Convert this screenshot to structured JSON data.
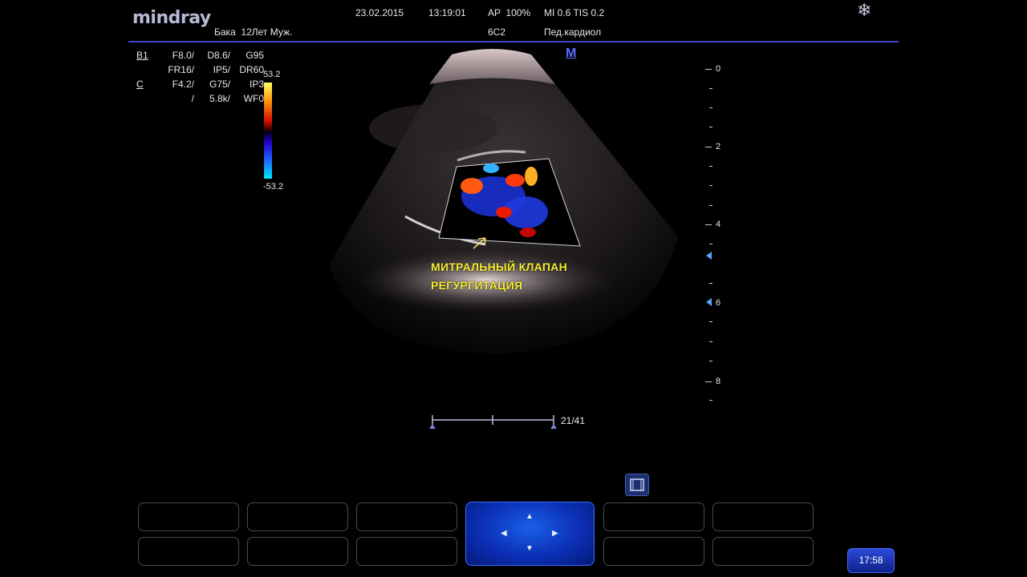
{
  "header": {
    "brand": "mindray",
    "date": "23.02.2015",
    "time": "13:19:01",
    "ap": "AP  100%",
    "mi_tis": "MI 0.6 TIS 0.2",
    "patient": "Бака  12Лет Муж.",
    "probe": "6C2",
    "preset": "Пед.кардиол",
    "freeze_icon": "snowflake-icon"
  },
  "params": {
    "rows": [
      {
        "k": "B1",
        "c1": "F8.0/",
        "c2": "D8.6/",
        "c3": "G95"
      },
      {
        "k": "",
        "c1": "FR16/",
        "c2": "IP5/",
        "c3": "DR60"
      },
      {
        "k": "C",
        "c1": "F4.2/",
        "c2": "G75/",
        "c3": "IP3"
      },
      {
        "k": "",
        "c1": "/",
        "c2": "5.8k/",
        "c3": "WF0"
      }
    ]
  },
  "colorbar": {
    "max": "53.2",
    "min": "-53.2"
  },
  "marker": "M",
  "depth_scale": {
    "labels": [
      "0",
      "2",
      "4",
      "6",
      "8"
    ]
  },
  "annotation": {
    "line1": "МИТРАЛЬНЫЙ КЛАПАН",
    "line2": "РЕГУРГИТАЦИЯ"
  },
  "cine": {
    "frame": "21/41"
  },
  "clock": "17:58",
  "colors": {
    "accent": "#3b47c8",
    "annotation": "#f6ec30",
    "nav": "#0b2fb5"
  }
}
